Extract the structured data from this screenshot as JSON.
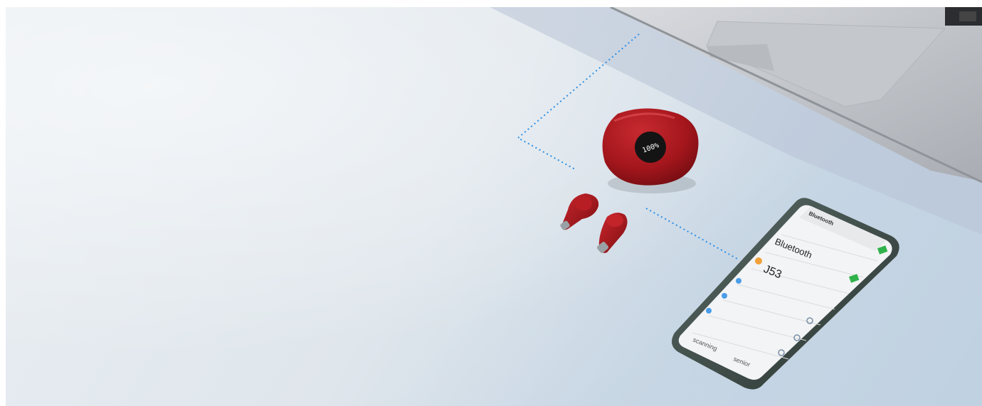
{
  "phone": {
    "nav_title": "Bluetooth",
    "section_title": "Bluetooth",
    "device_name": "J53",
    "left_action": "scanning",
    "right_action": "senior"
  },
  "case_display": {
    "digits": "100%"
  },
  "colors": {
    "product_red": "#a3161c",
    "connection_line": "#2d8fe6",
    "toggle_green": "#2fb24a",
    "laptop_silver": "#c9ccd1"
  }
}
